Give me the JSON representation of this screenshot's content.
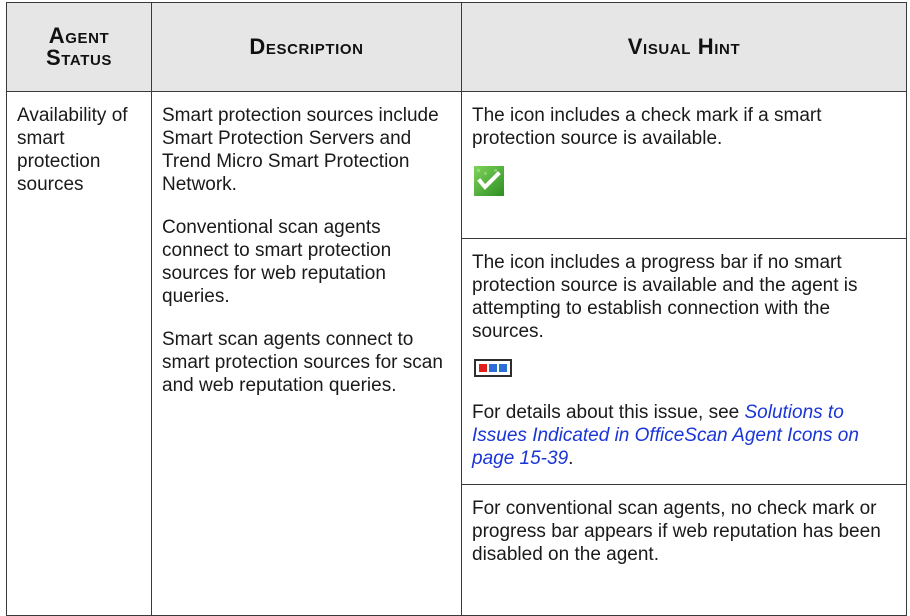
{
  "headers": {
    "status": "Agent Status",
    "description": "Description",
    "visual_hint": "Visual Hint"
  },
  "row": {
    "status": "Availability of smart protection sources",
    "description": [
      "Smart protection sources include Smart Protection Servers and Trend Micro Smart Protection Network.",
      "Conventional scan agents connect to smart protection sources for web reputation queries.",
      "Smart scan agents connect to smart protection sources for scan and web reputation queries."
    ],
    "hints": {
      "available": "The icon includes a check mark if a smart protection source is available.",
      "connecting": "The icon includes a progress bar if no smart protection source is available and the agent is attempting to establish connection with the sources.",
      "details_prefix": "For details about this issue, see ",
      "details_link": "Solutions to Issues Indicated in OfficeScan Agent Icons on page 15-39",
      "details_suffix": ".",
      "conventional": "For conventional scan agents, no check mark or progress bar appears if web reputation has been disabled on the agent."
    }
  },
  "icons": {
    "available": "check-mark-icon",
    "connecting": "progress-bar-icon"
  },
  "colors": {
    "header_bg": "#e6e6e6",
    "link": "#1a35d6",
    "check_green": "#3aa62a",
    "progress_red": "#e01e1e",
    "progress_blue": "#2b6fd6"
  }
}
